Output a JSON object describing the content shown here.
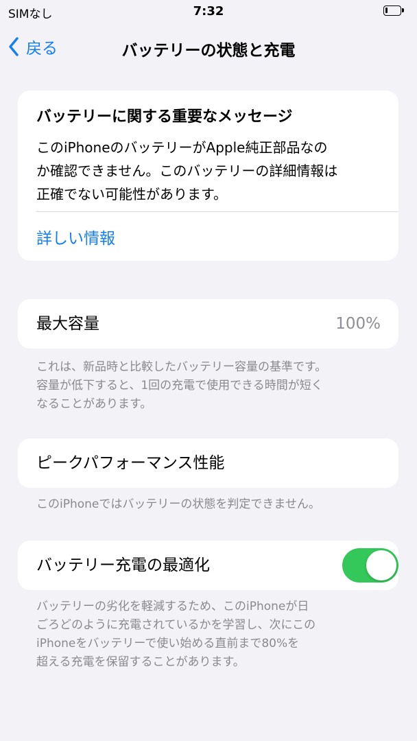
{
  "status_bar": {
    "carrier": "SIMなし",
    "time": "7:32",
    "battery_level_fraction": 0.15
  },
  "nav": {
    "back_label": "戻る",
    "title": "バッテリーの状態と充電"
  },
  "important_message": {
    "title": "バッテリーに関する重要なメッセージ",
    "body_lines": [
      "このiPhoneのバッテリーがApple純正部品なの",
      "か確認できません。このバッテリーの詳細情報は",
      "正確でない可能性があります。"
    ],
    "link_label": "詳しい情報"
  },
  "maximum_capacity": {
    "label": "最大容量",
    "value": "100%",
    "footnote_lines": [
      "これは、新品時と比較したバッテリー容量の基準です。",
      "容量が低下すると、1回の充電で使用できる時間が短く",
      "なることがあります。"
    ]
  },
  "peak_performance": {
    "label": "ピークパフォーマンス性能",
    "footnote": "このiPhoneではバッテリーの状態を判定できません。"
  },
  "optimized_charging": {
    "label": "バッテリー充電の最適化",
    "enabled": true,
    "footnote_lines": [
      "バッテリーの劣化を軽減するため、このiPhoneが日",
      "ごろどのように充電されているかを学習し、次にこの",
      "iPhoneをバッテリーで使い始める直前まで80%を",
      "超える充電を保留することがあります。"
    ]
  },
  "colors": {
    "background": "#f2f2f7",
    "accent_blue": "#157ef2",
    "toggle_on": "#34c759",
    "secondary_text": "#8a8a8e"
  },
  "icons": {
    "back": "chevron-left-icon",
    "battery": "battery-icon"
  }
}
